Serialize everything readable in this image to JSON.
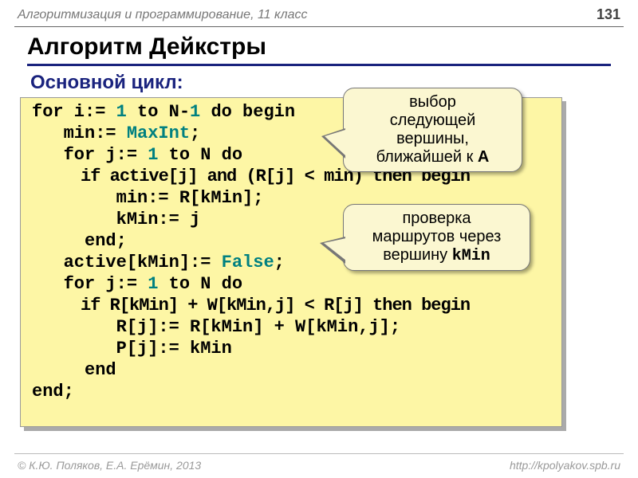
{
  "chapter": "Алгоритмизация и программирование, 11 класс",
  "page_number": "131",
  "title": "Алгоритм Дейкстры",
  "subtitle": "Основной цикл:",
  "code": {
    "l1a": "for i:= ",
    "l1b": "1",
    "l1c": " to N-",
    "l1d": "1",
    "l1e": " do begin",
    "l2a": "   min:= ",
    "l2b": "MaxInt",
    "l2c": ";",
    "l3a": "   for j:= ",
    "l3b": "1",
    "l3c": " to N do",
    "l4": "     if active[j] and (R[j] < min) then begin",
    "l5": "        min:= R[kMin];",
    "l6": "        kMin:= j",
    "l7": "     end;",
    "l8a": "   active[kMin]:= ",
    "l8b": "False",
    "l8c": ";",
    "l9a": "   for j:= ",
    "l9b": "1",
    "l9c": " to N do",
    "l10": "     if R[kMin] + W[kMin,j] < R[j] then begin",
    "l11": "        R[j]:= R[kMin] + W[kMin,j];",
    "l12": "        P[j]:= kMin",
    "l13": "     end",
    "l14": "end;"
  },
  "bubble1_line1": "выбор",
  "bubble1_line2": "следующей",
  "bubble1_line3": "вершины,",
  "bubble1_line4a": "ближайшей к ",
  "bubble1_line4b": "A",
  "bubble2_line1": "проверка",
  "bubble2_line2": "маршрутов через",
  "bubble2_line3a": "вершину ",
  "bubble2_line3b": "kMin",
  "footer_left": "© К.Ю. Поляков, Е.А. Ерёмин, 2013",
  "footer_right": "http://kpolyakov.spb.ru"
}
